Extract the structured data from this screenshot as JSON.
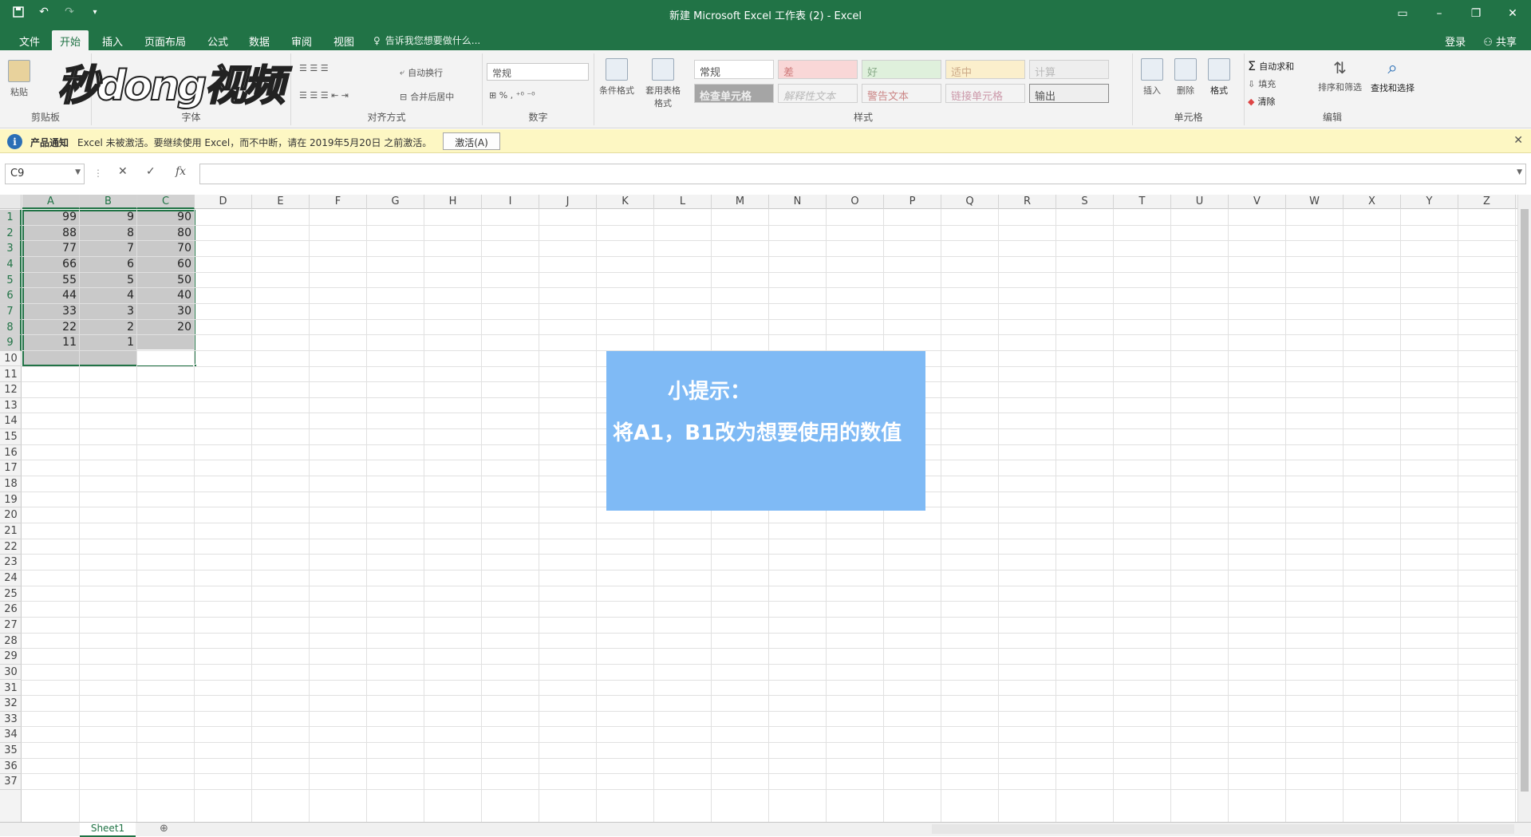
{
  "window": {
    "title": "新建 Microsoft Excel 工作表 (2) - Excel"
  },
  "qat": [
    "save-icon",
    "undo-icon",
    "redo-icon",
    "customize-icon"
  ],
  "tabs": [
    {
      "label": "文件",
      "active": false
    },
    {
      "label": "开始",
      "active": true
    },
    {
      "label": "插入",
      "active": false
    },
    {
      "label": "页面布局",
      "active": false
    },
    {
      "label": "公式",
      "active": false
    },
    {
      "label": "数据",
      "active": false
    },
    {
      "label": "审阅",
      "active": false
    },
    {
      "label": "视图",
      "active": false
    }
  ],
  "tell_me": "告诉我您想要做什么...",
  "account": {
    "signin": "登录",
    "share": "共享"
  },
  "ribbon": {
    "clipboard": {
      "label": "剪贴板",
      "paste": "粘贴"
    },
    "font": {
      "label": "字体"
    },
    "alignment": {
      "label": "对齐方式",
      "wrap": "自动换行",
      "merge": "合并后居中"
    },
    "number": {
      "label": "数字",
      "format": "常规"
    },
    "styles": {
      "label": "样式",
      "conditional": "条件格式",
      "table": "套用表格格式",
      "cells": [
        "常规",
        "差",
        "好",
        "适中",
        "计算",
        "检查单元格",
        "解释性文本",
        "警告文本",
        "链接单元格",
        "输出"
      ]
    },
    "cells": {
      "label": "单元格",
      "insert": "插入",
      "delete": "删除",
      "format": "格式"
    },
    "editing": {
      "label": "编辑",
      "autosum": "自动求和",
      "fill": "填充",
      "clear": "清除",
      "sort": "排序和筛选",
      "find": "查找和选择"
    }
  },
  "watermark": "秒dong视频",
  "notification": {
    "title": "产品通知",
    "message": "Excel 未被激活。要继续使用 Excel，而不中断，请在 2019年5月20日 之前激活。",
    "button": "激活(A)"
  },
  "formula_bar": {
    "name_box": "C9",
    "value": ""
  },
  "columns": [
    "A",
    "B",
    "C",
    "D",
    "E",
    "F",
    "G",
    "H",
    "I",
    "J",
    "K",
    "L",
    "M",
    "N",
    "O",
    "P",
    "Q",
    "R",
    "S",
    "T",
    "U",
    "V",
    "W",
    "X",
    "Y",
    "Z"
  ],
  "rows": [
    "1",
    "2",
    "3",
    "4",
    "5",
    "6",
    "7",
    "8",
    "9",
    "10",
    "11",
    "12",
    "13",
    "14",
    "15",
    "16",
    "17",
    "18",
    "19",
    "20",
    "21",
    "22",
    "23",
    "24",
    "25",
    "26",
    "27",
    "28",
    "29",
    "30",
    "31",
    "32",
    "33",
    "34",
    "35",
    "36",
    "37"
  ],
  "cells": [
    [
      "99",
      "9",
      "90"
    ],
    [
      "88",
      "8",
      "80"
    ],
    [
      "77",
      "7",
      "70"
    ],
    [
      "66",
      "6",
      "60"
    ],
    [
      "55",
      "5",
      "50"
    ],
    [
      "44",
      "4",
      "40"
    ],
    [
      "33",
      "3",
      "30"
    ],
    [
      "22",
      "2",
      "20"
    ],
    [
      "11",
      "1",
      ""
    ]
  ],
  "tip": {
    "title": "小提示：",
    "text": "将A1，B1改为想要使用的数值"
  },
  "sheets": [
    "Sheet1"
  ],
  "colors": {
    "accent": "#217346",
    "tip_bg": "#7fbaf5",
    "notify_bg": "#fdf7c3"
  }
}
